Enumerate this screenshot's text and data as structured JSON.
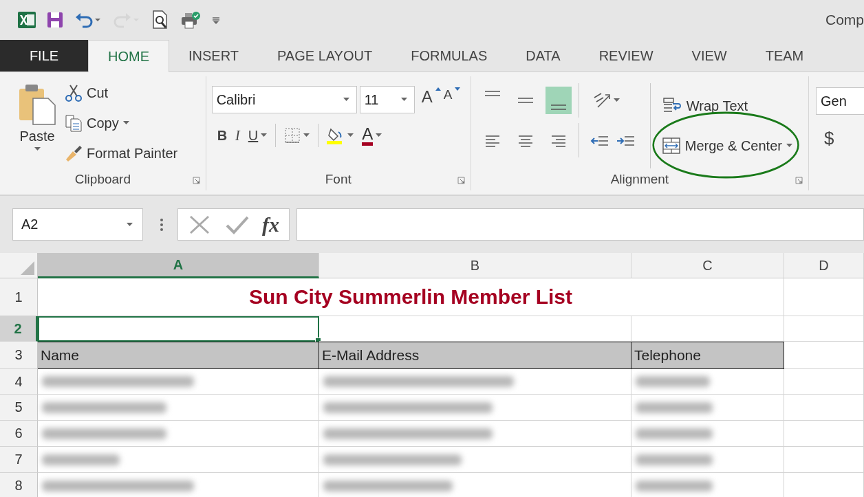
{
  "window": {
    "title": "Comp"
  },
  "quick_access": [
    {
      "kind": "excel",
      "disabled": false
    },
    {
      "kind": "save",
      "disabled": false
    },
    {
      "kind": "undo",
      "disabled": false
    },
    {
      "kind": "redo",
      "disabled": true
    },
    {
      "kind": "preview",
      "disabled": false
    },
    {
      "kind": "print",
      "disabled": false
    },
    {
      "kind": "customize",
      "disabled": false
    }
  ],
  "tabs": [
    {
      "label": "FILE",
      "kind": "file",
      "selected": false
    },
    {
      "label": "HOME",
      "kind": "tab",
      "selected": true
    },
    {
      "label": "INSERT",
      "kind": "tab",
      "selected": false
    },
    {
      "label": "PAGE LAYOUT",
      "kind": "tab",
      "selected": false
    },
    {
      "label": "FORMULAS",
      "kind": "tab",
      "selected": false
    },
    {
      "label": "DATA",
      "kind": "tab",
      "selected": false
    },
    {
      "label": "REVIEW",
      "kind": "tab",
      "selected": false
    },
    {
      "label": "VIEW",
      "kind": "tab",
      "selected": false
    },
    {
      "label": "TEAM",
      "kind": "tab",
      "selected": false
    }
  ],
  "ribbon": {
    "clipboard": {
      "title": "Clipboard",
      "paste": "Paste",
      "cut": "Cut",
      "copy": "Copy",
      "format_painter": "Format Painter"
    },
    "font": {
      "title": "Font",
      "font_name": "Calibri",
      "font_size": "11",
      "grow_font": "A",
      "shrink_font": "A",
      "bold": "B",
      "italic": "I",
      "underline": "U",
      "font_color": "A"
    },
    "alignment": {
      "title": "Alignment",
      "vertical_align": [
        {
          "selected": false
        },
        {
          "selected": false
        },
        {
          "selected": true
        }
      ],
      "wrap_text": "Wrap Text",
      "merge_center": "Merge & Center",
      "circled": true
    },
    "number": {
      "format": "Gen",
      "currency": "$"
    }
  },
  "formula_bar": {
    "name_box": "A2",
    "fx": "fx"
  },
  "sheet": {
    "columns": [
      {
        "label": "A",
        "selected": true
      },
      {
        "label": "B",
        "selected": false
      },
      {
        "label": "C",
        "selected": false
      },
      {
        "label": "D",
        "selected": false
      }
    ],
    "rows": [
      {
        "number": "1",
        "selected": false,
        "kind": "title",
        "text": "Sun City Summerlin Member List"
      },
      {
        "number": "2",
        "selected": true,
        "kind": "empty"
      },
      {
        "number": "3",
        "selected": false,
        "kind": "header",
        "cells": [
          "Name",
          "E-Mail Address",
          "Telephone"
        ]
      },
      {
        "number": "4",
        "selected": false,
        "kind": "blurred"
      },
      {
        "number": "5",
        "selected": false,
        "kind": "blurred"
      },
      {
        "number": "6",
        "selected": false,
        "kind": "blurred"
      },
      {
        "number": "7",
        "selected": false,
        "kind": "blurred"
      },
      {
        "number": "8",
        "selected": false,
        "kind": "blurred"
      }
    ]
  }
}
